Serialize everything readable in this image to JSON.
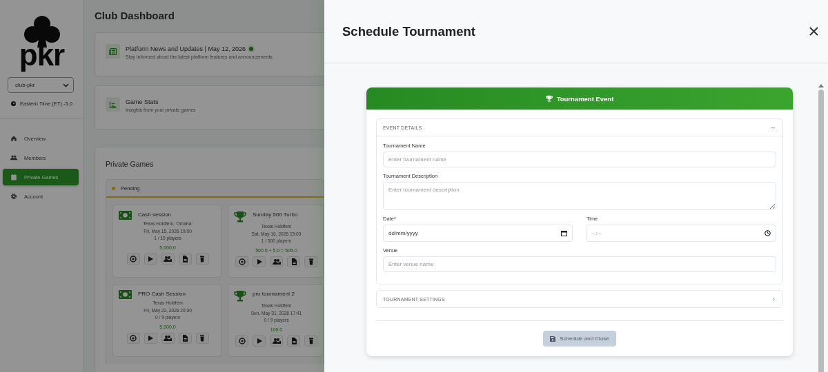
{
  "sidebar": {
    "logo": "pkr",
    "club_select": "club-pkr",
    "timezone": "Eastern Time (ET) -5.0",
    "items": [
      {
        "label": "Overview",
        "selected": false
      },
      {
        "label": "Members",
        "selected": false
      },
      {
        "label": "Private Games",
        "selected": true
      },
      {
        "label": "Account",
        "selected": false
      }
    ]
  },
  "dashboard": {
    "title": "Club Dashboard",
    "cards": [
      {
        "title": "Platform News and Updates | May 12, 2026",
        "subtitle": "Stay informed about the latest platform features and announcements",
        "live": true
      },
      {
        "title": "Game Stats",
        "subtitle": "Insights from your private games",
        "live": false
      }
    ],
    "private_games": {
      "title": "Private Games",
      "status": "Pending",
      "games": [
        {
          "kind": "cash",
          "name": "Cash session",
          "game_type": "Texas Holdfem, 'Omaha'",
          "datetime": "Fri, May 15, 2026 19:00",
          "players": "1 / 10 players",
          "amount": "5,000.0"
        },
        {
          "kind": "tournament",
          "name": "Sunday 500 Turbo",
          "game_type": "Texas Holdfem",
          "datetime": "Sat, May 16, 2026 19:00",
          "players": "1 / 500 players",
          "amount": "500.0 + 5.0 = 505.0"
        },
        {
          "kind": "cash",
          "name": "PRO Cash Session",
          "game_type": "Texas Holdfem",
          "datetime": "Fri, May 22, 2026 20:00",
          "players": "0 / 9 players",
          "amount": "5,000.0"
        },
        {
          "kind": "tournament",
          "name": "pro tournament 2",
          "game_type": "Texas Holdfem",
          "datetime": "Sun, May 31, 2026 17:41",
          "players": "0 / 9 players",
          "amount": "100.0"
        }
      ]
    }
  },
  "drawer": {
    "title": "Schedule Tournament",
    "event_title": "Tournament Event",
    "sections": [
      {
        "title": "EVENT DETAILS",
        "expanded": true,
        "fields": [
          {
            "kind": "text",
            "label": "Tournament Name",
            "placeholder": "Enter tournament name"
          },
          {
            "kind": "textarea",
            "label": "Tournament Description",
            "placeholder": "Enter tournament description"
          },
          {
            "kind": "date",
            "label": "Date*",
            "placeholder": "dd/mm/yyyy"
          },
          {
            "kind": "time",
            "label": "Time",
            "placeholder": "--:--"
          },
          {
            "kind": "text",
            "label": "Venue",
            "placeholder": "Enter venue name"
          }
        ]
      },
      {
        "title": "TOURNAMENT SETTINGS",
        "expanded": false
      }
    ],
    "submit": {
      "label": "Schedule and Close",
      "disabled": true
    }
  }
}
